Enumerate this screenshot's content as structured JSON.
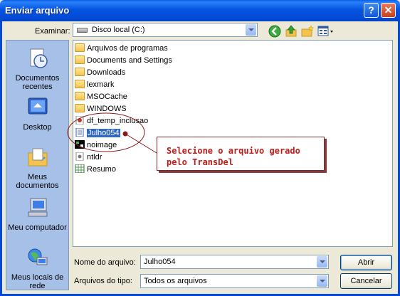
{
  "window": {
    "title": "Enviar arquivo",
    "help": "?",
    "close": "✕"
  },
  "lookin": {
    "label": "Examinar:",
    "value": "Disco local (C:)"
  },
  "places": [
    {
      "label": "Documentos recentes"
    },
    {
      "label": "Desktop"
    },
    {
      "label": "Meus documentos"
    },
    {
      "label": "Meu computador"
    },
    {
      "label": "Meus locais de rede"
    }
  ],
  "files": [
    {
      "name": "Arquivos de programas",
      "kind": "folder"
    },
    {
      "name": "Documents and Settings",
      "kind": "folder"
    },
    {
      "name": "Downloads",
      "kind": "folder"
    },
    {
      "name": "lexmark",
      "kind": "folder"
    },
    {
      "name": "MSOCache",
      "kind": "folder"
    },
    {
      "name": "WINDOWS",
      "kind": "folder"
    },
    {
      "name": "df_temp_inclusao",
      "kind": "file"
    },
    {
      "name": "Julho054",
      "kind": "file",
      "selected": true
    },
    {
      "name": "noimage",
      "kind": "file"
    },
    {
      "name": "ntldr",
      "kind": "file"
    },
    {
      "name": "Resumo",
      "kind": "file"
    }
  ],
  "filename": {
    "label": "Nome do arquivo:",
    "value": "Julho054"
  },
  "filetype": {
    "label": "Arquivos do tipo:",
    "value": "Todos os arquivos"
  },
  "buttons": {
    "open": "Abrir",
    "cancel": "Cancelar"
  },
  "callout": {
    "text": "Selecione o arquivo gerado pelo TransDel"
  },
  "colors": {
    "titlebar": "#0454e2",
    "selection": "#316ac5",
    "callout_text": "#c11b17",
    "annotation": "#8a1a1a"
  }
}
